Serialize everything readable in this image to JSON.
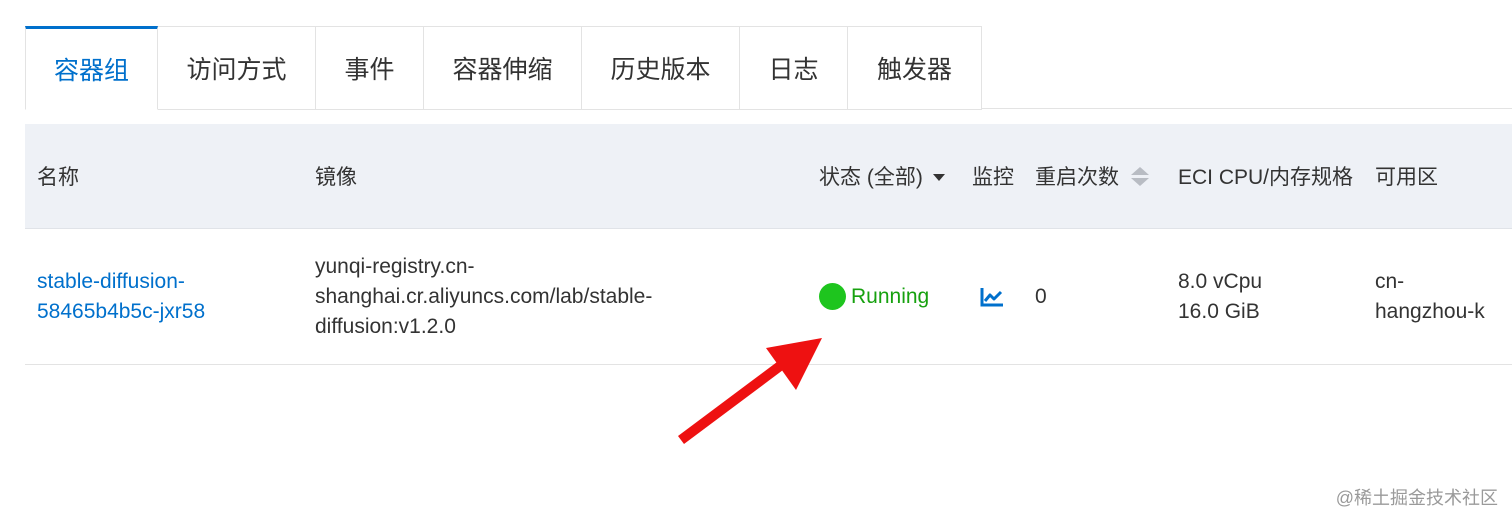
{
  "tabs": [
    {
      "label": "容器组"
    },
    {
      "label": "访问方式"
    },
    {
      "label": "事件"
    },
    {
      "label": "容器伸缩"
    },
    {
      "label": "历史版本"
    },
    {
      "label": "日志"
    },
    {
      "label": "触发器"
    }
  ],
  "table": {
    "headers": {
      "name": "名称",
      "image": "镜像",
      "status": "状态 (全部)",
      "monitor": "监控",
      "restarts": "重启次数",
      "spec": "ECI CPU/内存规格",
      "zone": "可用区"
    },
    "row": {
      "name_line1": "stable-diffusion-",
      "name_line2": "58465b4b5c-jxr58",
      "image_line1": "yunqi-registry.cn-",
      "image_line2": "shanghai.cr.aliyuncs.com/lab/stable-",
      "image_line3": "diffusion:v1.2.0",
      "status": "Running",
      "restarts": "0",
      "cpu": "8.0 vCpu",
      "memory": "16.0 GiB",
      "zone_line1": "cn-",
      "zone_line2": "hangzhou-k"
    }
  },
  "colors": {
    "accent": "#0070cc",
    "running_dot": "#1ec51e",
    "running_text": "#17a10f",
    "annotation_arrow": "#ee1111"
  },
  "watermark": "@稀土掘金技术社区"
}
